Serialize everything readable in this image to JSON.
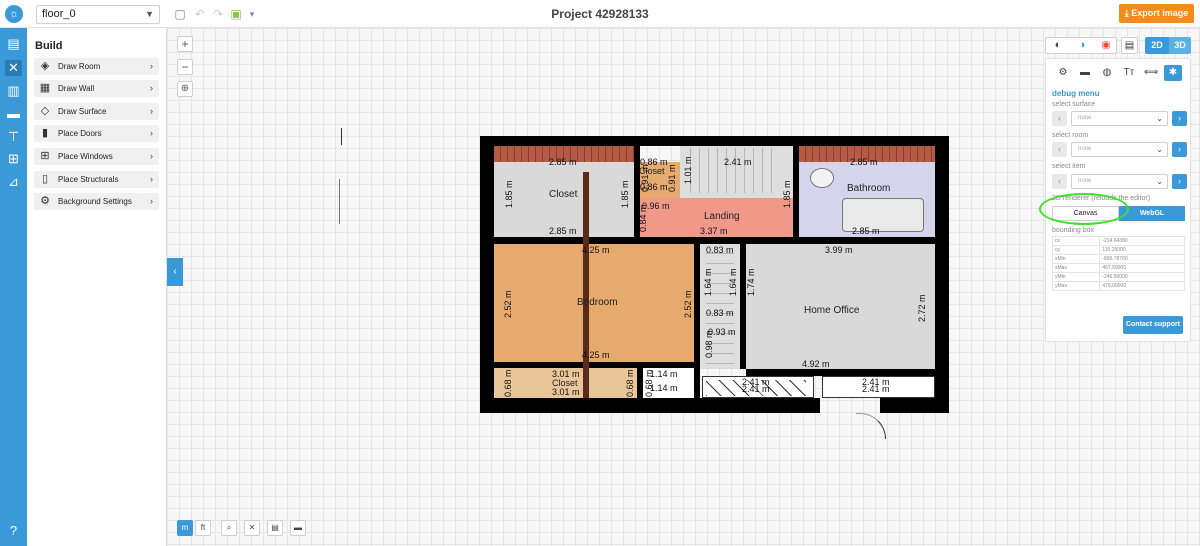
{
  "topbar": {
    "floor_select": "floor_0",
    "project_title": "Project 42928133",
    "export_label": "Export image"
  },
  "build": {
    "title": "Build",
    "items": [
      {
        "label": "Draw Room",
        "icon": "cube-icon"
      },
      {
        "label": "Draw Wall",
        "icon": "wall-icon"
      },
      {
        "label": "Draw Surface",
        "icon": "surface-icon"
      },
      {
        "label": "Place Doors",
        "icon": "door-icon"
      },
      {
        "label": "Place Windows",
        "icon": "window-icon"
      },
      {
        "label": "Place Structurals",
        "icon": "column-icon"
      },
      {
        "label": "Background Settings",
        "icon": "settings-icon"
      }
    ]
  },
  "plan": {
    "rooms": {
      "closet1": "Closet",
      "closet2": "Closet",
      "closet3": "Closet",
      "landing": "Landing",
      "bathroom": "Bathroom",
      "bedroom": "Bedroom",
      "office": "Home Office"
    },
    "dims": {
      "d_closet_top": "2.85 m",
      "d_closet_bottom": "2.85 m",
      "d_closet_left": "1.85 m",
      "d_closet_right": "1.85 m",
      "d_small_top": "0.86 m",
      "d_small_mid": "0.86 m",
      "d_small_v1": "0.91 m",
      "d_small_v2": "0.91 m",
      "d_stair_top": "2.41 m",
      "d_stair_v": "1.01 m",
      "d_landing_top": "0.96 m",
      "d_landing_bottom": "3.37 m",
      "d_landing_v": "0.84 m",
      "d_bath_top": "2.85 m",
      "d_bath_bottom": "2.85 m",
      "d_bath_v": "1.85 m",
      "d_bed_top": "4.25 m",
      "d_bed_bottom": "4.25 m",
      "d_bed_left": "2.52 m",
      "d_bed_right": "2.52 m",
      "d_stair2_top": "0.83 m",
      "d_stair2_bottom": "0.83 m",
      "d_stair2_v1": "1.64 m",
      "d_stair2_v2": "1.64 m",
      "d_office_top": "3.99 m",
      "d_office_left": "1.74 m",
      "d_office_mid": "0.93 m",
      "d_office_v": "0.98 m",
      "d_office_right": "2.72 m",
      "d_office_bottom": "4.92 m",
      "d_c3_top": "3.01 m",
      "d_c3_bottom": "3.01 m",
      "d_c3_left": "0.68 m",
      "d_c3_right": "0.68 m",
      "d_c4_top": "1.14 m",
      "d_c4_bottom": "1.14 m",
      "d_c4_v": "0.68 m",
      "d_bottom1": "2.41 m",
      "d_bottom2": "2.41 m",
      "d_bottom3": "2.41 m",
      "d_bottom4": "2.41 m"
    }
  },
  "units": {
    "m": "m",
    "ft": "ft"
  },
  "view": {
    "d2": "2D",
    "d3": "3D"
  },
  "debug": {
    "title": "debug menu",
    "select_surface_label": "select surface",
    "select_room_label": "select room",
    "select_item_label": "select item",
    "none": "none",
    "renderer_label": "2D renderer (reloads the editor)",
    "canvas_label": "Canvas",
    "webgl_label": "WebGL",
    "bbox_label": "bounding box",
    "bbox": [
      {
        "k": "cx",
        "v": "-214.64380"
      },
      {
        "k": "cy",
        "v": "116.25000"
      },
      {
        "k": "xMin",
        "v": "-896.78760"
      },
      {
        "k": "xMax",
        "v": "467.50000"
      },
      {
        "k": "yMin",
        "v": "-246.50000"
      },
      {
        "k": "yMax",
        "v": "479.00000"
      }
    ],
    "contact_label": "Contact support"
  },
  "colors": {
    "accent": "#3a9ad9",
    "export": "#f58a1f",
    "bedroom": "#e6a96e",
    "landing": "#f0998a",
    "bathroom": "#d6d3ec",
    "highlight": "#3ee02a"
  }
}
